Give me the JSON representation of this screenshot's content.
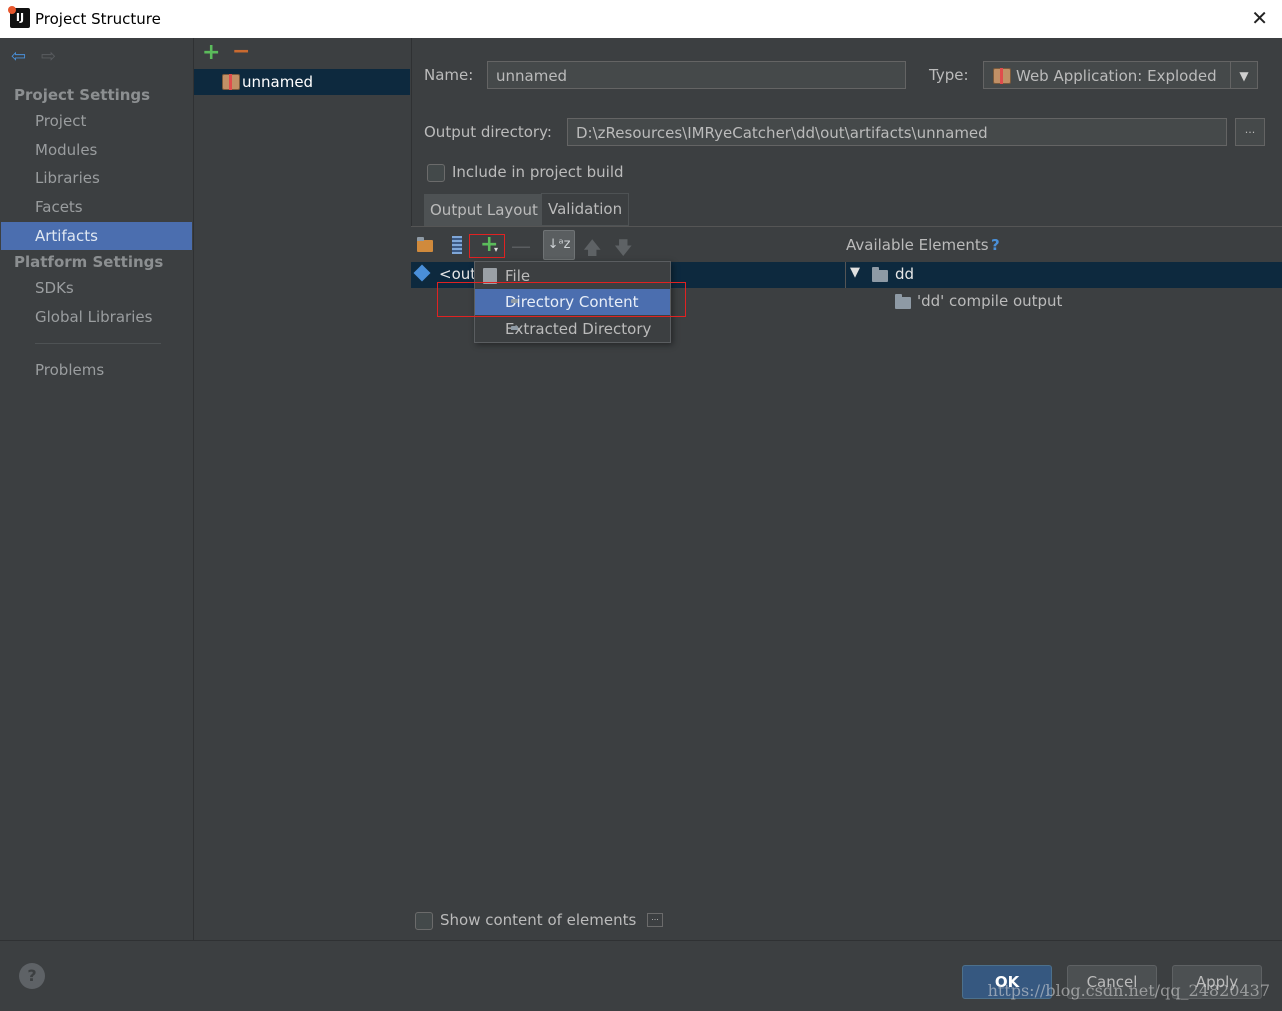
{
  "window": {
    "title": "Project Structure",
    "app_icon": "intellij-icon"
  },
  "sidebar": {
    "project_settings_header": "Project Settings",
    "project_items": [
      {
        "label": "Project",
        "active": false
      },
      {
        "label": "Modules",
        "active": false
      },
      {
        "label": "Libraries",
        "active": false
      },
      {
        "label": "Facets",
        "active": false
      },
      {
        "label": "Artifacts",
        "active": true
      }
    ],
    "platform_settings_header": "Platform Settings",
    "platform_items": [
      {
        "label": "SDKs"
      },
      {
        "label": "Global Libraries"
      }
    ],
    "problems_label": "Problems"
  },
  "artifact_list": {
    "items": [
      "unnamed"
    ]
  },
  "artifact": {
    "name_label": "Name:",
    "name_value": "unnamed",
    "type_label": "Type:",
    "type_value": "Web Application: Exploded",
    "output_dir_label": "Output directory:",
    "output_dir_value": "D:\\zResources\\IMRyeCatcher\\dd\\out\\artifacts\\unnamed",
    "browse_label": "...",
    "include_build_label": "Include in project build",
    "include_build_checked": false
  },
  "tabs": [
    "Output Layout",
    "Validation"
  ],
  "layout_tree": {
    "root_label": "<out"
  },
  "available": {
    "header": "Available Elements",
    "help": "?",
    "tree": [
      {
        "label": "dd",
        "expanded": true
      },
      {
        "label": "'dd' compile output"
      }
    ]
  },
  "popup_menu": {
    "items": [
      {
        "label": "File",
        "icon": "file-icon"
      },
      {
        "label": "Directory Content",
        "icon": "folder-icon",
        "highlighted": true
      },
      {
        "label": "Extracted Directory",
        "icon": "extracted-directory-icon"
      }
    ]
  },
  "show_content_label": "Show content of elements",
  "show_content_more": "...",
  "buttons": {
    "ok": "OK",
    "cancel": "Cancel",
    "apply": "Apply",
    "help": "?"
  },
  "watermark": "https://blog.csdn.net/qq_24820437",
  "colors": {
    "accent": "#4b6eaf",
    "selection": "#0d293e",
    "background": "#3c3f41",
    "highlight_box": "#e02222"
  }
}
